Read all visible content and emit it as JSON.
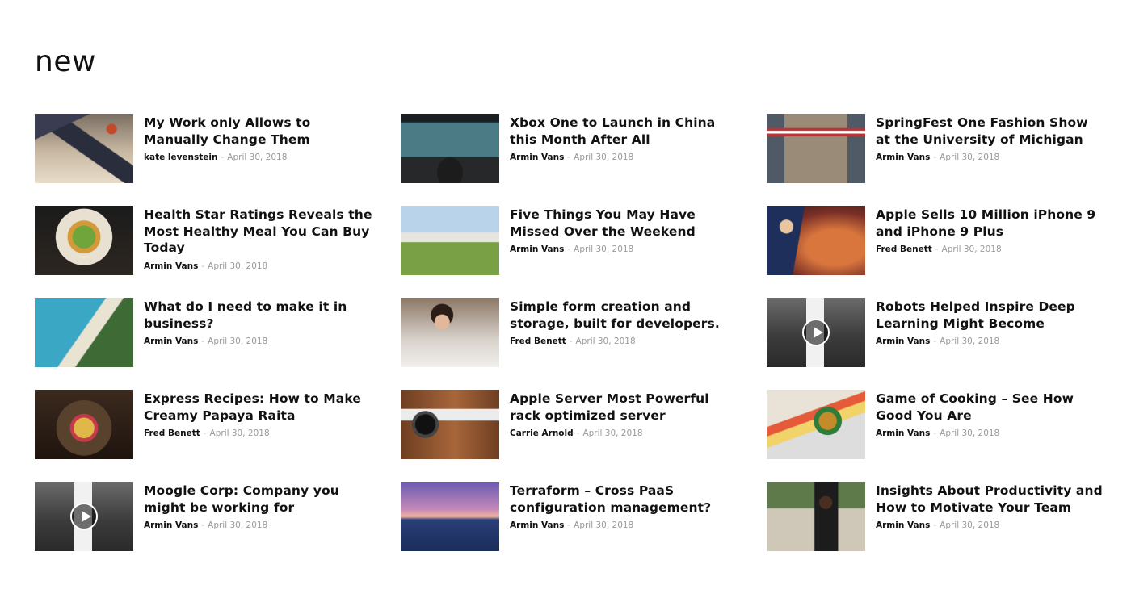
{
  "section": {
    "title": "new"
  },
  "posts": [
    {
      "title": "My Work only Allows to Manually Change Them",
      "author": "kate levenstein",
      "date": "April 30, 2018",
      "image": "laptop-desk",
      "video": false
    },
    {
      "title": "Xbox One to Launch in China this Month After All",
      "author": "Armin Vans",
      "date": "April 30, 2018",
      "image": "gaming-controller",
      "video": false
    },
    {
      "title": "SpringFest One Fashion Show at the University of Michigan",
      "author": "Armin Vans",
      "date": "April 30, 2018",
      "image": "building-flag",
      "video": false
    },
    {
      "title": "Health Star Ratings Reveals the Most Healthy Meal You Can Buy Today",
      "author": "Armin Vans",
      "date": "April 30, 2018",
      "image": "salad-plate",
      "video": false
    },
    {
      "title": "Five Things You May Have Missed Over the Weekend",
      "author": "Armin Vans",
      "date": "April 30, 2018",
      "image": "white-house",
      "video": false
    },
    {
      "title": "Apple Sells 10 Million iPhone 9 and iPhone 9 Plus",
      "author": "Fred Benett",
      "date": "April 30, 2018",
      "image": "conference-speaker",
      "video": false
    },
    {
      "title": "What do I need to make it in business?",
      "author": "Armin Vans",
      "date": "April 30, 2018",
      "image": "beach-aerial",
      "video": false
    },
    {
      "title": "Simple form creation and storage, built for developers.",
      "author": "Fred Benett",
      "date": "April 30, 2018",
      "image": "woman-coffee",
      "video": false
    },
    {
      "title": "Robots Helped Inspire Deep Learning Might Become",
      "author": "Armin Vans",
      "date": "April 30, 2018",
      "image": "phone-street",
      "video": true
    },
    {
      "title": "Express Recipes: How to Make Creamy Papaya Raita",
      "author": "Fred Benett",
      "date": "April 30, 2018",
      "image": "food-plate",
      "video": false
    },
    {
      "title": "Apple Server Most Powerful rack optimized server",
      "author": "Carrie Arnold",
      "date": "April 30, 2018",
      "image": "desk-turntable",
      "video": false
    },
    {
      "title": "Game of Cooking – See How Good You Are",
      "author": "Armin Vans",
      "date": "April 30, 2018",
      "image": "pineapple-table",
      "video": false
    },
    {
      "title": "Moogle Corp: Company you might be working for",
      "author": "Armin Vans",
      "date": "April 30, 2018",
      "image": "phone-street",
      "video": true
    },
    {
      "title": "Terraform – Cross PaaS configuration management?",
      "author": "Armin Vans",
      "date": "April 30, 2018",
      "image": "bridge-sunset",
      "video": false
    },
    {
      "title": "Insights About Productivity and How to Motivate Your Team",
      "author": "Armin Vans",
      "date": "April 30, 2018",
      "image": "man-bench",
      "video": false
    }
  ]
}
